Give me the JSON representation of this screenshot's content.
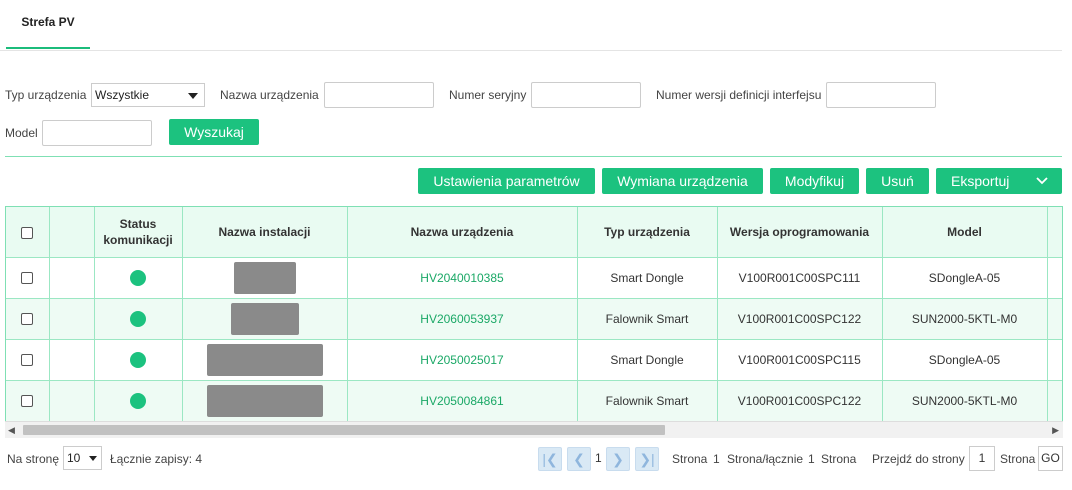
{
  "tabs": [
    {
      "label": "Strefa PV"
    }
  ],
  "filters": {
    "device_type_label": "Typ urządzenia",
    "device_type_value": "Wszystkie",
    "device_name_label": "Nazwa urządzenia",
    "serial_label": "Numer seryjny",
    "interface_version_label": "Numer wersji definicji interfejsu",
    "model_label": "Model",
    "search_button": "Wyszukaj"
  },
  "toolbar": {
    "parameters": "Ustawienia parametrów",
    "replace": "Wymiana urządzenia",
    "modify": "Modyfikuj",
    "delete": "Usuń",
    "export": "Eksportuj"
  },
  "table": {
    "headers": {
      "status": "Status komunikacji",
      "plant": "Nazwa instalacji",
      "device": "Nazwa urządzenia",
      "type": "Typ urządzenia",
      "software": "Wersja oprogramowania",
      "model": "Model"
    },
    "rows": [
      {
        "device": "HV2040010385",
        "type": "Smart Dongle",
        "software": "V100R001C00SPC111",
        "model": "SDongleA-05",
        "status_color": "#1cc27f"
      },
      {
        "device": "HV2060053937",
        "type": "Falownik Smart",
        "software": "V100R001C00SPC122",
        "model": "SUN2000-5KTL-M0",
        "status_color": "#1cc27f"
      },
      {
        "device": "HV2050025017",
        "type": "Smart Dongle",
        "software": "V100R001C00SPC115",
        "model": "SDongleA-05",
        "status_color": "#1cc27f"
      },
      {
        "device": "HV2050084861",
        "type": "Falownik Smart",
        "software": "V100R001C00SPC122",
        "model": "SUN2000-5KTL-M0",
        "status_color": "#1cc27f"
      }
    ]
  },
  "pagination": {
    "per_page_label": "Na stronę",
    "per_page_value": "10",
    "total_label": "Łącznie zapisy: 4",
    "current_page": "1",
    "page_label": "Strona",
    "page_num": "1",
    "page_total_label": "Strona/łącznie",
    "page_total": "1",
    "page_suffix": "Strona",
    "goto_label": "Przejdź do strony",
    "goto_value": "1",
    "goto_suffix": "Strona",
    "go_button": "GO"
  }
}
